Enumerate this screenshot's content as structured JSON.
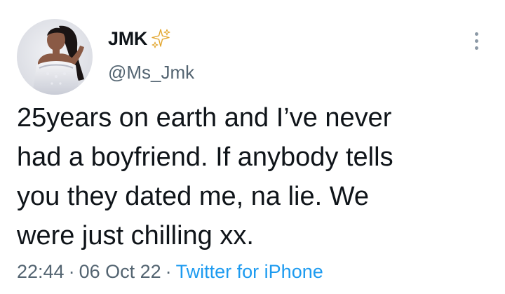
{
  "author": {
    "display_name": "JMK",
    "badge_icon": "sparkles-icon",
    "handle": "@Ms_Jmk"
  },
  "tweet": {
    "lines": [
      "25years on earth and I’ve never",
      "had a boyfriend. If anybody tells",
      "you they dated me, na lie. We",
      "were just chilling xx."
    ]
  },
  "meta": {
    "time": "22:44",
    "separator": "·",
    "date": "06 Oct 22",
    "source": "Twitter for iPhone"
  },
  "colors": {
    "text": "#0f1419",
    "secondary": "#536471",
    "link": "#1d9bf0",
    "sparkle": "#f4c542"
  }
}
